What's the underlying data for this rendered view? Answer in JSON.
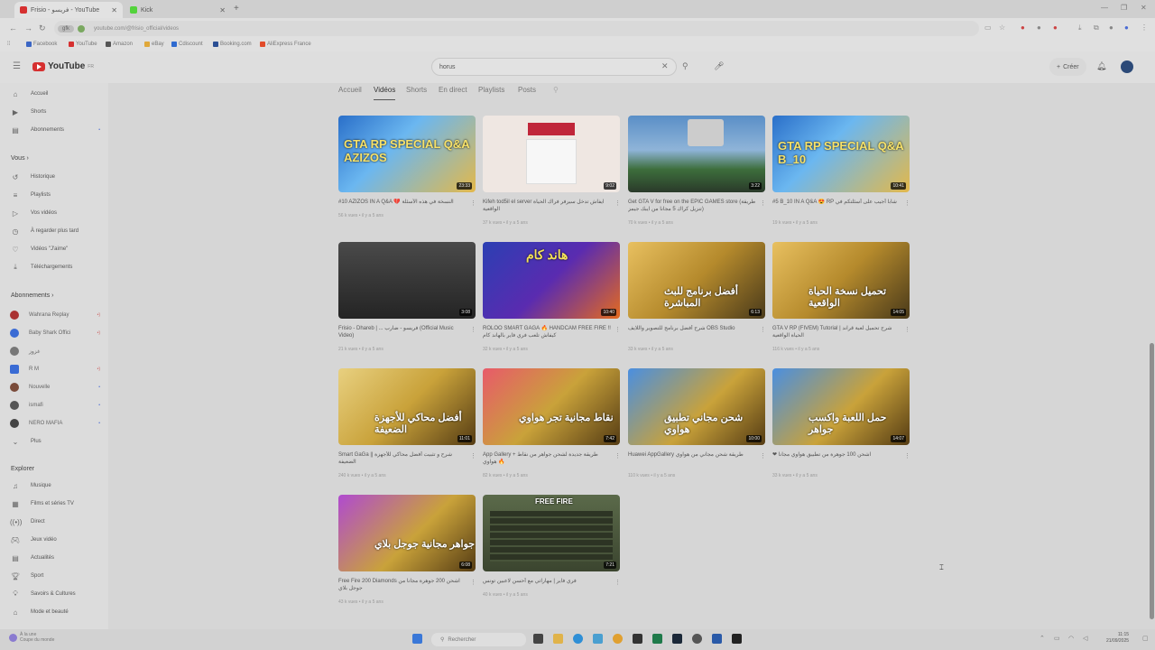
{
  "browser": {
    "tabs": [
      {
        "title": "Frisio - فريسو - YouTube",
        "color": "#d63030"
      },
      {
        "title": "Kick",
        "color": "#53d33b"
      }
    ],
    "url": "youtube.com/@frisio_official/videos",
    "url_chip": "gfk",
    "bookmarks": [
      {
        "label": "Facebook",
        "color": "#3b66c4"
      },
      {
        "label": "YouTube",
        "color": "#d63030"
      },
      {
        "label": "Amazon",
        "color": "#555555"
      },
      {
        "label": "eBay",
        "color": "#e0a83a"
      },
      {
        "label": "Cdiscount",
        "color": "#2f6bd0"
      },
      {
        "label": "Booking.com",
        "color": "#2b4f94"
      },
      {
        "label": "AliExpress France",
        "color": "#e24b2a"
      }
    ]
  },
  "youtube": {
    "logo": "YouTube",
    "logo_sup": "FR",
    "search_value": "horus",
    "create_label": "Créer",
    "channel_tabs": [
      "Accueil",
      "Vidéos",
      "Shorts",
      "En direct",
      "Playlists",
      "Posts"
    ],
    "active_tab": "Vidéos"
  },
  "sidebar": {
    "main": [
      {
        "label": "Accueil",
        "icon": "home-icon"
      },
      {
        "label": "Shorts",
        "icon": "shorts-icon"
      },
      {
        "label": "Abonnements",
        "icon": "subscriptions-icon"
      }
    ],
    "you_header": "Vous",
    "you": [
      {
        "label": "Historique",
        "icon": "history-icon"
      },
      {
        "label": "Playlists",
        "icon": "playlist-icon"
      },
      {
        "label": "Vos vidéos",
        "icon": "video-icon"
      },
      {
        "label": "À regarder plus tard",
        "icon": "clock-icon"
      },
      {
        "label": "Vidéos \"J'aime\"",
        "icon": "like-icon"
      },
      {
        "label": "Téléchargements",
        "icon": "download-icon"
      }
    ],
    "subs_header": "Abonnements",
    "subs": [
      {
        "label": "Wahrana Replay",
        "color": "#aa3333",
        "live": "•)"
      },
      {
        "label": "Baby Shark Offici",
        "color": "#3a6bd4",
        "live": "•)"
      },
      {
        "label": "غزوز",
        "color": "#777777",
        "live": ""
      },
      {
        "label": "R M",
        "color": "#3a6bd4",
        "live": "•)"
      },
      {
        "label": "Nouvelle",
        "color": "#7a4b3a",
        "live": "•"
      },
      {
        "label": "ismafi",
        "color": "#555555",
        "live": "•"
      },
      {
        "label": "NERO MAFIA",
        "color": "#444444",
        "live": "•"
      }
    ],
    "more_label": "Plus",
    "explore_header": "Explorer",
    "explore": [
      {
        "label": "Musique",
        "icon": "music-icon"
      },
      {
        "label": "Films et séries TV",
        "icon": "film-icon"
      },
      {
        "label": "Direct",
        "icon": "live-icon"
      },
      {
        "label": "Jeux vidéo",
        "icon": "gamepad-icon"
      },
      {
        "label": "Actualités",
        "icon": "news-icon"
      },
      {
        "label": "Sport",
        "icon": "trophy-icon"
      },
      {
        "label": "Savoirs & Cultures",
        "icon": "bulb-icon"
      },
      {
        "label": "Mode et beauté",
        "icon": "hanger-icon"
      }
    ]
  },
  "videos": [
    {
      "title": "#10 AZIZOS IN A Q&A 💔 النسخة في هذه الأسئلة",
      "meta": "56 k vues • il y a 5 ans",
      "duration": "23:33",
      "thumb": "GTA RP SPECIAL Q&A AZIZOS"
    },
    {
      "title": "Kifeh tod5il el server ايفاش تدخل سيرفر فراك الحياة الواقعية",
      "meta": "37 k vues • il y a 5 ans",
      "duration": "9:02",
      "thumb": ""
    },
    {
      "title": "Get GTA V for free on the EPIC GAMES store (طريقة تنزيل كراك 5 مجانا من ايبك جيمز)",
      "meta": "70 k vues • il y a 5 ans",
      "duration": "3:22",
      "thumb": ""
    },
    {
      "title": "#5 B_10 IN A Q&A 😍 RP شابا أجيب على أسئلتكم في",
      "meta": "19 k vues • il y a 5 ans",
      "duration": "10:41",
      "thumb": "GTA RP SPECIAL Q&A B_10"
    },
    {
      "title": "Frisio - Dhareb | ... فريسو - ضارب (Official Music Video)",
      "meta": "21 k vues • il y a 5 ans",
      "duration": "3:08",
      "thumb": ""
    },
    {
      "title": "ROLOO SMART GAGA 🔥 HANDCAM FREE FIRE !! كيفاش تلعب فري فاير بالهاند كام",
      "meta": "32 k vues • il y a 5 ans",
      "duration": "10:40",
      "thumb": "هاند كام"
    },
    {
      "title": "شرح أفضل برنامج للتصوير واللايف OBS Studio",
      "meta": "33 k vues • il y a 5 ans",
      "duration": "6:13",
      "thumb": "أفضل برنامج للبث المباشرة"
    },
    {
      "title": "GTA V RP (FIVEM) Tutorial | شرح تحميل لعبة قراند الحياة الواقعية",
      "meta": "116 k vues • il y a 5 ans",
      "duration": "14:05",
      "thumb": "تحميل نسخة الحياة الواقعية"
    },
    {
      "title": "Smart GaGa || شرح و تثبيت أفضل محاكي للأجهزة الضعيفة",
      "meta": "240 k vues • il y a 5 ans",
      "duration": "11:01",
      "thumb": "أفضل محاكي للأجهزة الضعيفة"
    },
    {
      "title": "App Gallery + طريقة جديدة لشحن جواهر من نقاط هواوي 🔥",
      "meta": "82 k vues • il y a 5 ans",
      "duration": "7:42",
      "thumb": "نقاط مجانية تجر هواوي"
    },
    {
      "title": "Huawei AppGallery طريقة شحن مجاني من هواوي",
      "meta": "110 k vues • il y a 5 ans",
      "duration": "10:00",
      "thumb": "شحن مجاني تطبيق هواوي"
    },
    {
      "title": "❤ اشحن 100 جوهرة من تطبيق هواوي مجانا",
      "meta": "33 k vues • il y a 5 ans",
      "duration": "14:07",
      "thumb": "حمل اللعبة واكسب جواهر"
    },
    {
      "title": "Free Fire 200 Diamonds اشحن 200 جوهرة مجانا من جوجل بلاي",
      "meta": "43 k vues • il y a 5 ans",
      "duration": "6:08",
      "thumb": "جواهر مجانية جوجل بلاي"
    },
    {
      "title": "فري فاير | مهاراتي مع أحسن لاعبين تونس",
      "meta": "40 k vues • il y a 5 ans",
      "duration": "7:21",
      "thumb": "FREE FIRE"
    }
  ],
  "taskbar": {
    "weather_line1": "À la une",
    "weather_line2": "Coupe du monde",
    "search_label": "Rechercher",
    "time": "11:15",
    "date": "21/09/2025"
  },
  "colors": {
    "yt_red": "#d63030",
    "accent_blue": "#3a6bd4"
  }
}
